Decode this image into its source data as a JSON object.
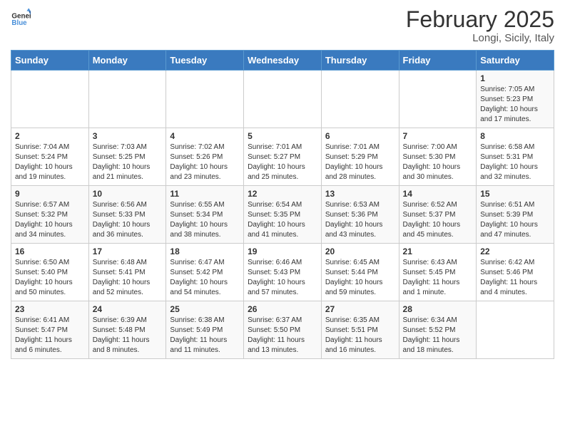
{
  "header": {
    "logo_general": "General",
    "logo_blue": "Blue",
    "title": "February 2025",
    "subtitle": "Longi, Sicily, Italy"
  },
  "calendar": {
    "weekdays": [
      "Sunday",
      "Monday",
      "Tuesday",
      "Wednesday",
      "Thursday",
      "Friday",
      "Saturday"
    ],
    "weeks": [
      [
        {
          "day": "",
          "info": ""
        },
        {
          "day": "",
          "info": ""
        },
        {
          "day": "",
          "info": ""
        },
        {
          "day": "",
          "info": ""
        },
        {
          "day": "",
          "info": ""
        },
        {
          "day": "",
          "info": ""
        },
        {
          "day": "1",
          "info": "Sunrise: 7:05 AM\nSunset: 5:23 PM\nDaylight: 10 hours\nand 17 minutes."
        }
      ],
      [
        {
          "day": "2",
          "info": "Sunrise: 7:04 AM\nSunset: 5:24 PM\nDaylight: 10 hours\nand 19 minutes."
        },
        {
          "day": "3",
          "info": "Sunrise: 7:03 AM\nSunset: 5:25 PM\nDaylight: 10 hours\nand 21 minutes."
        },
        {
          "day": "4",
          "info": "Sunrise: 7:02 AM\nSunset: 5:26 PM\nDaylight: 10 hours\nand 23 minutes."
        },
        {
          "day": "5",
          "info": "Sunrise: 7:01 AM\nSunset: 5:27 PM\nDaylight: 10 hours\nand 25 minutes."
        },
        {
          "day": "6",
          "info": "Sunrise: 7:01 AM\nSunset: 5:29 PM\nDaylight: 10 hours\nand 28 minutes."
        },
        {
          "day": "7",
          "info": "Sunrise: 7:00 AM\nSunset: 5:30 PM\nDaylight: 10 hours\nand 30 minutes."
        },
        {
          "day": "8",
          "info": "Sunrise: 6:58 AM\nSunset: 5:31 PM\nDaylight: 10 hours\nand 32 minutes."
        }
      ],
      [
        {
          "day": "9",
          "info": "Sunrise: 6:57 AM\nSunset: 5:32 PM\nDaylight: 10 hours\nand 34 minutes."
        },
        {
          "day": "10",
          "info": "Sunrise: 6:56 AM\nSunset: 5:33 PM\nDaylight: 10 hours\nand 36 minutes."
        },
        {
          "day": "11",
          "info": "Sunrise: 6:55 AM\nSunset: 5:34 PM\nDaylight: 10 hours\nand 38 minutes."
        },
        {
          "day": "12",
          "info": "Sunrise: 6:54 AM\nSunset: 5:35 PM\nDaylight: 10 hours\nand 41 minutes."
        },
        {
          "day": "13",
          "info": "Sunrise: 6:53 AM\nSunset: 5:36 PM\nDaylight: 10 hours\nand 43 minutes."
        },
        {
          "day": "14",
          "info": "Sunrise: 6:52 AM\nSunset: 5:37 PM\nDaylight: 10 hours\nand 45 minutes."
        },
        {
          "day": "15",
          "info": "Sunrise: 6:51 AM\nSunset: 5:39 PM\nDaylight: 10 hours\nand 47 minutes."
        }
      ],
      [
        {
          "day": "16",
          "info": "Sunrise: 6:50 AM\nSunset: 5:40 PM\nDaylight: 10 hours\nand 50 minutes."
        },
        {
          "day": "17",
          "info": "Sunrise: 6:48 AM\nSunset: 5:41 PM\nDaylight: 10 hours\nand 52 minutes."
        },
        {
          "day": "18",
          "info": "Sunrise: 6:47 AM\nSunset: 5:42 PM\nDaylight: 10 hours\nand 54 minutes."
        },
        {
          "day": "19",
          "info": "Sunrise: 6:46 AM\nSunset: 5:43 PM\nDaylight: 10 hours\nand 57 minutes."
        },
        {
          "day": "20",
          "info": "Sunrise: 6:45 AM\nSunset: 5:44 PM\nDaylight: 10 hours\nand 59 minutes."
        },
        {
          "day": "21",
          "info": "Sunrise: 6:43 AM\nSunset: 5:45 PM\nDaylight: 11 hours\nand 1 minute."
        },
        {
          "day": "22",
          "info": "Sunrise: 6:42 AM\nSunset: 5:46 PM\nDaylight: 11 hours\nand 4 minutes."
        }
      ],
      [
        {
          "day": "23",
          "info": "Sunrise: 6:41 AM\nSunset: 5:47 PM\nDaylight: 11 hours\nand 6 minutes."
        },
        {
          "day": "24",
          "info": "Sunrise: 6:39 AM\nSunset: 5:48 PM\nDaylight: 11 hours\nand 8 minutes."
        },
        {
          "day": "25",
          "info": "Sunrise: 6:38 AM\nSunset: 5:49 PM\nDaylight: 11 hours\nand 11 minutes."
        },
        {
          "day": "26",
          "info": "Sunrise: 6:37 AM\nSunset: 5:50 PM\nDaylight: 11 hours\nand 13 minutes."
        },
        {
          "day": "27",
          "info": "Sunrise: 6:35 AM\nSunset: 5:51 PM\nDaylight: 11 hours\nand 16 minutes."
        },
        {
          "day": "28",
          "info": "Sunrise: 6:34 AM\nSunset: 5:52 PM\nDaylight: 11 hours\nand 18 minutes."
        },
        {
          "day": "",
          "info": ""
        }
      ]
    ]
  }
}
